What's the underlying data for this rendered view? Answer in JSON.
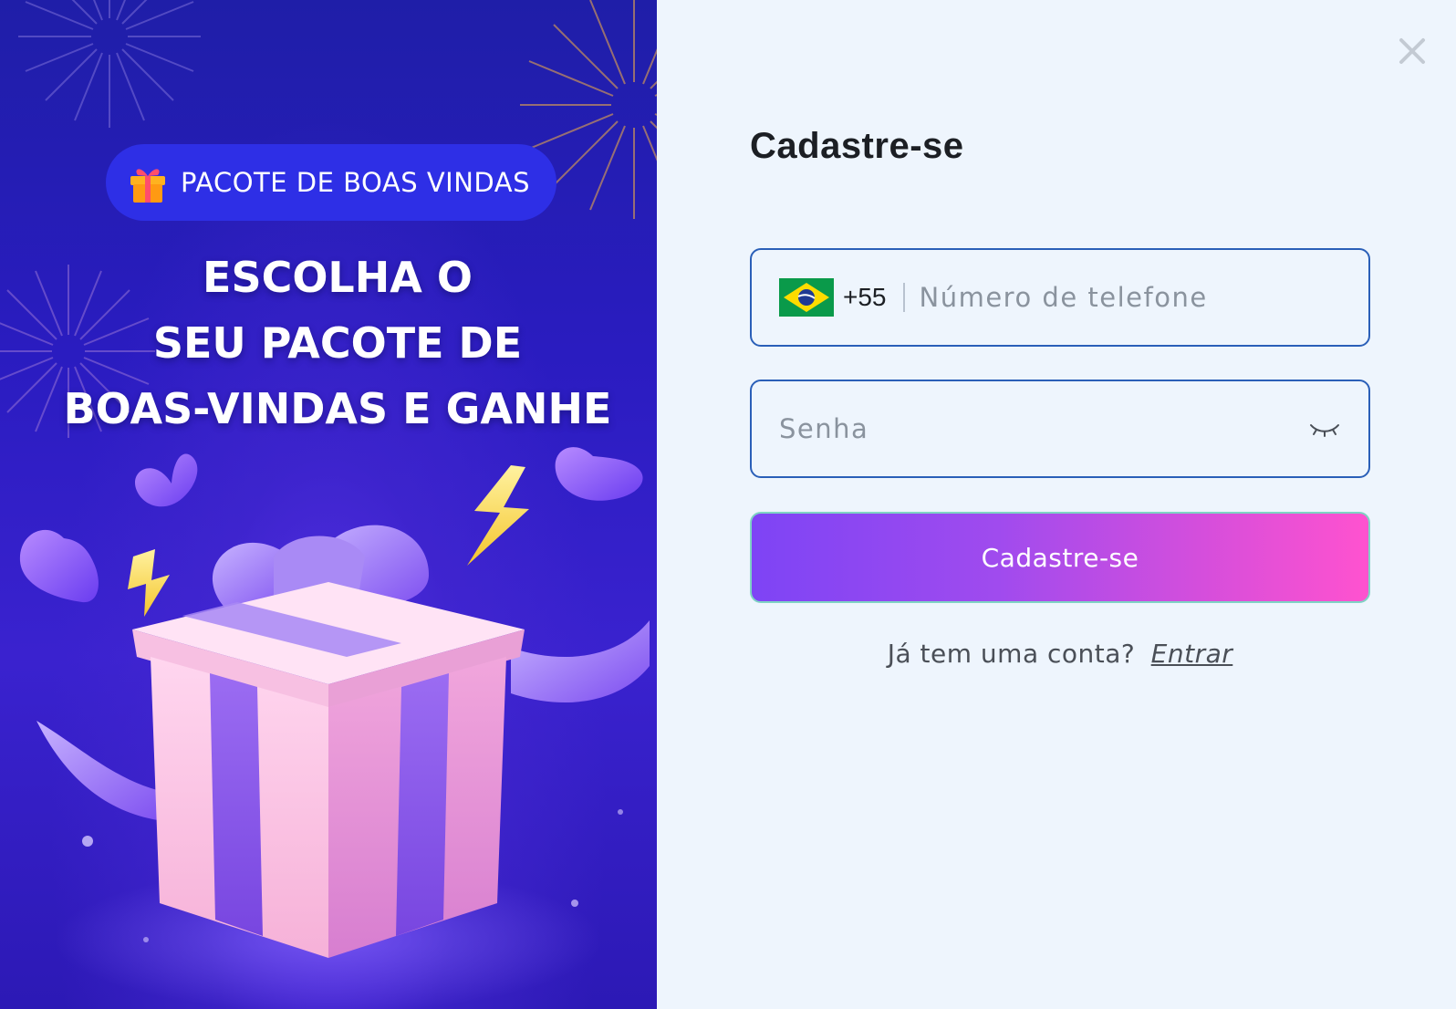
{
  "promo": {
    "badge_text": "PACOTE DE BOAS VINDAS",
    "headline": [
      "ESCOLHA O",
      "SEU PACOTE DE",
      "BOAS-VINDAS E GANHE"
    ],
    "badge_icon": "gift-icon",
    "illustration": "gift-box-illustration"
  },
  "form": {
    "title": "Cadastre-se",
    "phone": {
      "country_flag": "brazil-flag-icon",
      "dial_code": "+55",
      "placeholder": "Número de telefone",
      "value": ""
    },
    "password": {
      "placeholder": "Senha",
      "value": "",
      "toggle_icon": "eye-closed-icon"
    },
    "submit_label": "Cadastre-se",
    "login_prompt": "Já tem uma conta?",
    "login_link": "Entrar",
    "close_icon": "close-icon"
  },
  "colors": {
    "promo_bg": "#2a1cc0",
    "form_bg": "#eef5fd",
    "field_border": "#2a5fb8",
    "button_gradient_start": "#7e44f5",
    "button_gradient_end": "#ff52cf"
  }
}
